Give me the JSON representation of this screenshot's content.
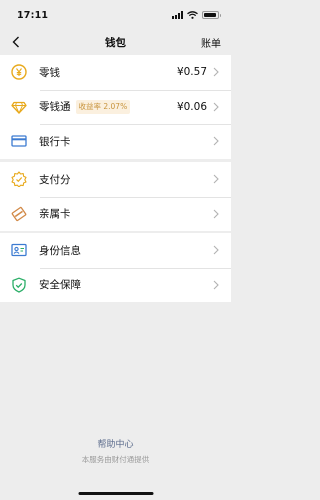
{
  "status_bar": {
    "time": "17:11"
  },
  "nav": {
    "title": "钱包",
    "right": "账单"
  },
  "group1": {
    "change": {
      "label": "零钱",
      "value": "¥0.57"
    },
    "lct": {
      "label": "零钱通",
      "badge": "收益率 2.07%",
      "value": "¥0.06"
    },
    "bankcard": {
      "label": "银行卡"
    }
  },
  "group2": {
    "pay_score": {
      "label": "支付分"
    },
    "family_card": {
      "label": "亲属卡"
    }
  },
  "group3": {
    "identity": {
      "label": "身份信息"
    },
    "security": {
      "label": "安全保障"
    }
  },
  "footer": {
    "help": "帮助中心",
    "provider": "本服务由财付通提供"
  },
  "colors": {
    "gold": "#e8a91b",
    "blue": "#3c7bd1",
    "green": "#2aae67",
    "orange": "#d28a48"
  }
}
